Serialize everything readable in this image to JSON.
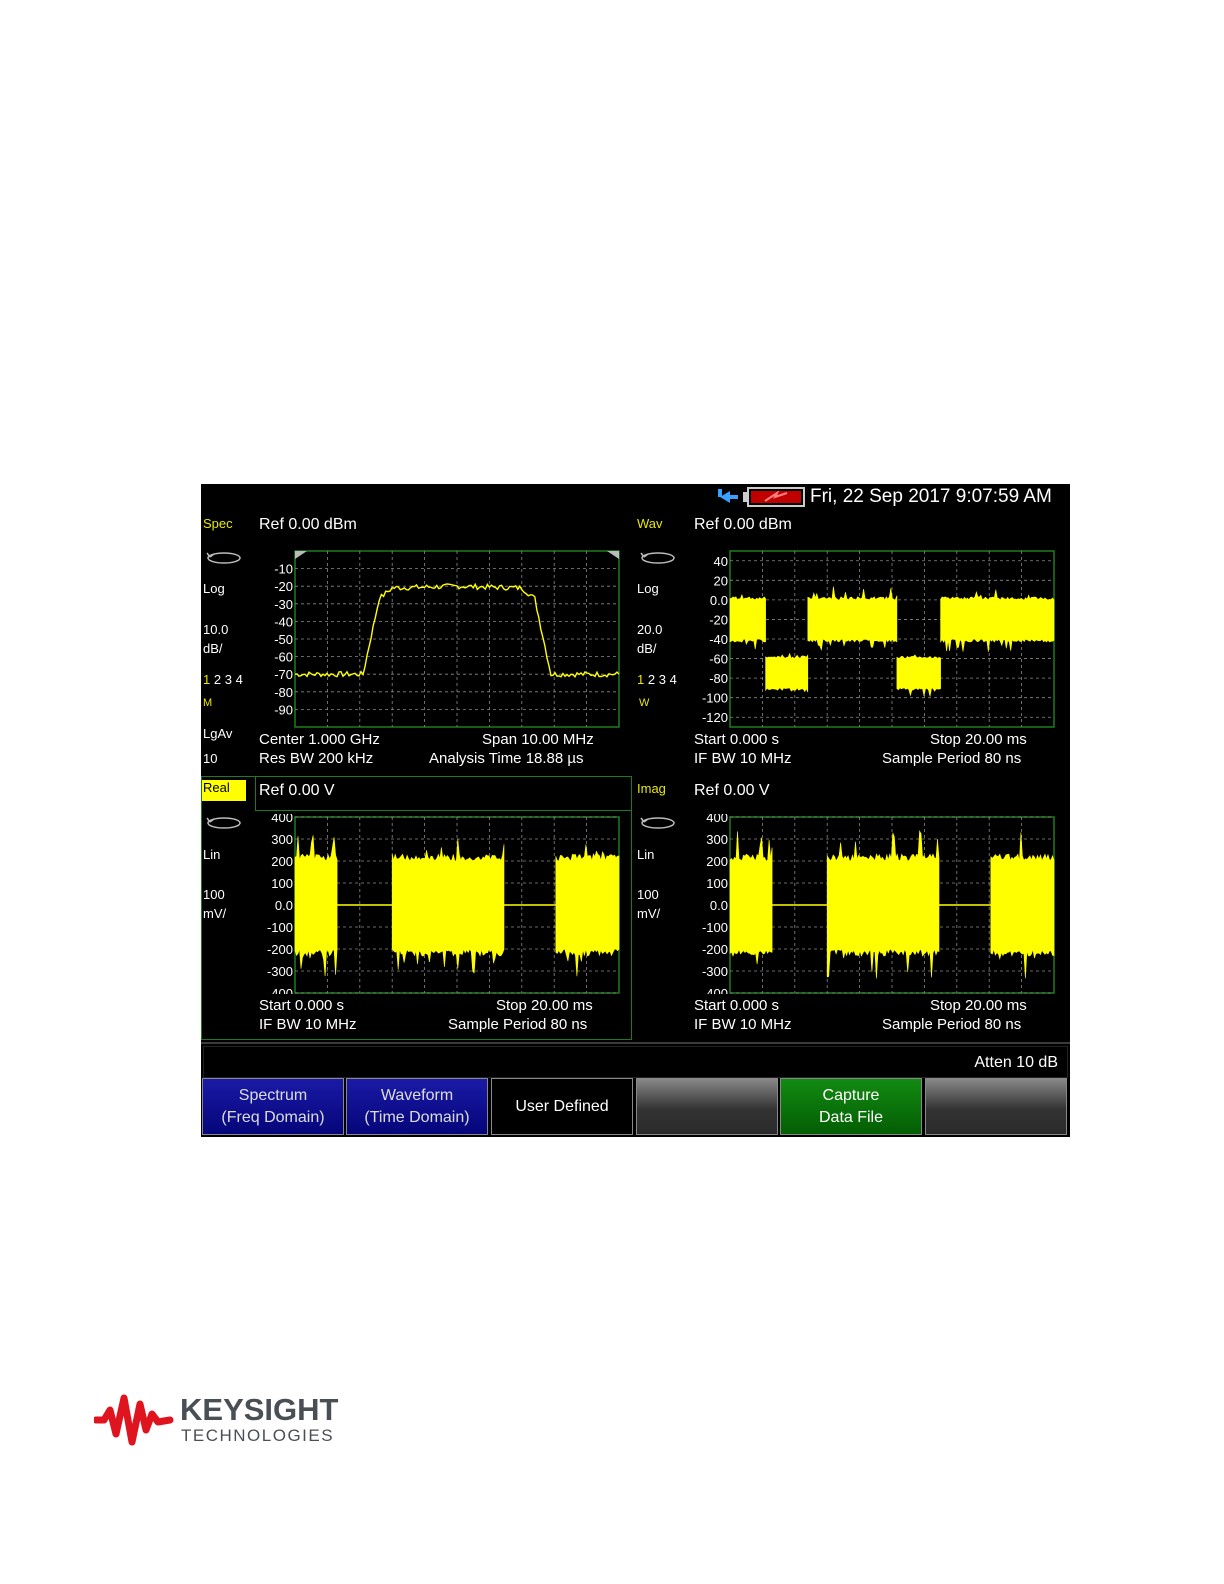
{
  "status_bar": {
    "datetime": "Fri, 22 Sep 2017 9:07:59 AM"
  },
  "panes": [
    {
      "id": "spec",
      "mode_label": "Spec",
      "ref": "Ref 0.00 dBm",
      "scale_type": "Log",
      "scale_value": "10.0",
      "scale_unit": "dB/",
      "traces": [
        "1",
        "2",
        "3",
        "4"
      ],
      "trace_mode": "M",
      "detector": "LgAv",
      "avg_count": "10",
      "y_ticks": [
        "-10",
        "-20",
        "-30",
        "-40",
        "-50",
        "-60",
        "-70",
        "-80",
        "-90"
      ],
      "footer_left_1": "Center 1.000 GHz",
      "footer_right_1": "Span 10.00 MHz",
      "footer_left_2": "Res BW 200 kHz",
      "footer_right_2": "Analysis Time 18.88 µs"
    },
    {
      "id": "wav",
      "mode_label": "Wav",
      "ref": "Ref 0.00 dBm",
      "scale_type": "Log",
      "scale_value": "20.0",
      "scale_unit": "dB/",
      "traces": [
        "1",
        "2",
        "3",
        "4"
      ],
      "trace_mode": "W",
      "y_ticks": [
        "40",
        "20",
        "0.0",
        "-20",
        "-40",
        "-60",
        "-80",
        "-100",
        "-120"
      ],
      "footer_left_1": "Start 0.000  s",
      "footer_right_1": "Stop 20.00 ms",
      "footer_left_2": "IF BW 10 MHz",
      "footer_right_2": "Sample Period 80 ns"
    },
    {
      "id": "real",
      "mode_label": "Real",
      "ref": "Ref 0.00 V",
      "scale_type": "Lin",
      "scale_value": "100",
      "scale_unit": "mV/",
      "y_ticks": [
        "400",
        "300",
        "200",
        "100",
        "0.0",
        "-100",
        "-200",
        "-300",
        "-400"
      ],
      "footer_left_1": "Start 0.000  s",
      "footer_right_1": "Stop 20.00 ms",
      "footer_left_2": "IF BW 10 MHz",
      "footer_right_2": "Sample Period 80 ns"
    },
    {
      "id": "imag",
      "mode_label": "Imag",
      "ref": "Ref 0.00 V",
      "scale_type": "Lin",
      "scale_value": "100",
      "scale_unit": "mV/",
      "y_ticks": [
        "400",
        "300",
        "200",
        "100",
        "0.0",
        "-100",
        "-200",
        "-300",
        "-400"
      ],
      "footer_left_1": "Start 0.000  s",
      "footer_right_1": "Stop 20.00 ms",
      "footer_left_2": "IF BW 10 MHz",
      "footer_right_2": "Sample Period 80 ns"
    }
  ],
  "bottom_status": {
    "atten": "Atten 10  dB"
  },
  "softkeys": [
    {
      "line1": "Spectrum",
      "line2": "(Freq Domain)"
    },
    {
      "line1": "Waveform",
      "line2": "(Time Domain)"
    },
    {
      "line1": "User Defined",
      "line2": ""
    },
    {
      "line1": "",
      "line2": ""
    },
    {
      "line1": "Capture",
      "line2": "Data File"
    },
    {
      "line1": "",
      "line2": ""
    }
  ],
  "logo": {
    "line1": "KEYSIGHT",
    "line2": "TECHNOLOGIES"
  },
  "colors": {
    "trace": "#ffff00",
    "grid": "#1f7a1f",
    "label": "#e8e800",
    "softkey_blue": "#0a0a8c",
    "softkey_green": "#0a7a0a",
    "logo_red": "#e0141e"
  },
  "chart_data": [
    {
      "type": "line",
      "id": "spectrum",
      "ylim": [
        -100,
        0
      ],
      "xlim": [
        995,
        1005
      ],
      "x_unit": "MHz",
      "series": [
        {
          "points": [
            [
              995,
              -70
            ],
            [
              997.1,
              -70
            ],
            [
              997.6,
              -27
            ],
            [
              998,
              -21
            ],
            [
              1000,
              -20
            ],
            [
              1002,
              -21
            ],
            [
              1002.4,
              -27
            ],
            [
              1002.9,
              -70
            ],
            [
              1005,
              -70
            ]
          ]
        }
      ]
    },
    {
      "type": "area",
      "id": "waveform",
      "ylim": [
        -130,
        50
      ],
      "xlim": [
        0,
        20
      ],
      "x_unit": "ms",
      "segments": [
        {
          "x0": 0.0,
          "x1": 2.2,
          "hi": 0,
          "lo": -40
        },
        {
          "x0": 2.2,
          "x1": 4.8,
          "hi": -60,
          "lo": -90
        },
        {
          "x0": 4.8,
          "x1": 10.3,
          "hi": 0,
          "lo": -40
        },
        {
          "x0": 10.3,
          "x1": 13.0,
          "hi": -60,
          "lo": -90
        },
        {
          "x0": 13.0,
          "x1": 20.0,
          "hi": 0,
          "lo": -40
        }
      ]
    },
    {
      "type": "area",
      "id": "real",
      "ylim": [
        -400,
        400
      ],
      "xlim": [
        0,
        20
      ],
      "x_unit": "ms",
      "segments": [
        {
          "x0": 0.0,
          "x1": 2.6,
          "hi": 200,
          "lo": -200
        },
        {
          "x0": 6.0,
          "x1": 12.9,
          "hi": 200,
          "lo": -200
        },
        {
          "x0": 16.1,
          "x1": 20.0,
          "hi": 200,
          "lo": -200
        }
      ]
    },
    {
      "type": "area",
      "id": "imag",
      "ylim": [
        -400,
        400
      ],
      "xlim": [
        0,
        20
      ],
      "x_unit": "ms",
      "segments": [
        {
          "x0": 0.0,
          "x1": 2.6,
          "hi": 200,
          "lo": -200
        },
        {
          "x0": 6.0,
          "x1": 12.9,
          "hi": 200,
          "lo": -200
        },
        {
          "x0": 16.1,
          "x1": 20.0,
          "hi": 200,
          "lo": -200
        }
      ]
    }
  ]
}
